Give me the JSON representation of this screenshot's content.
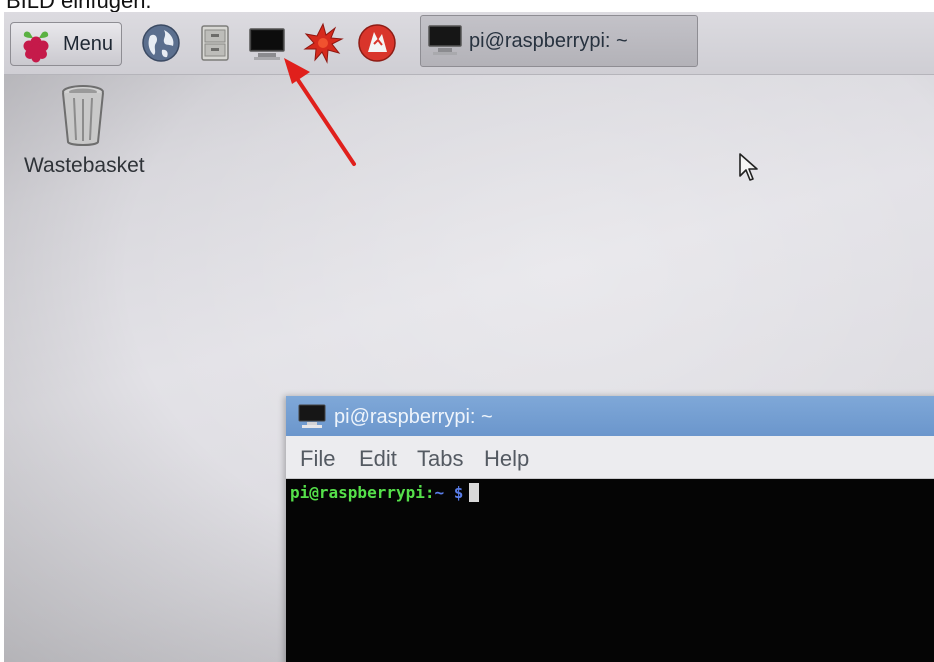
{
  "caption": "BILD einfügen.",
  "taskbar": {
    "menu_label": "Menu",
    "launchers": [
      {
        "icon": "web-browser-icon"
      },
      {
        "icon": "file-manager-icon"
      },
      {
        "icon": "terminal-icon"
      },
      {
        "icon": "mathematica-icon"
      },
      {
        "icon": "wolfram-icon"
      }
    ],
    "task_window_label": "pi@raspberrypi: ~"
  },
  "desktop": {
    "wastebasket_label": "Wastebasket"
  },
  "terminal": {
    "title": "pi@raspberrypi: ~",
    "menu": [
      "File",
      "Edit",
      "Tabs",
      "Help"
    ],
    "prompt_user": "pi@raspberrypi",
    "prompt_sep": ":",
    "prompt_path": "~",
    "prompt_symbol": "$"
  },
  "colors": {
    "annotation_arrow": "#e0201c",
    "title_bar": "#7fa8d8",
    "prompt_user": "#55e04a",
    "prompt_path": "#5a7de8"
  }
}
